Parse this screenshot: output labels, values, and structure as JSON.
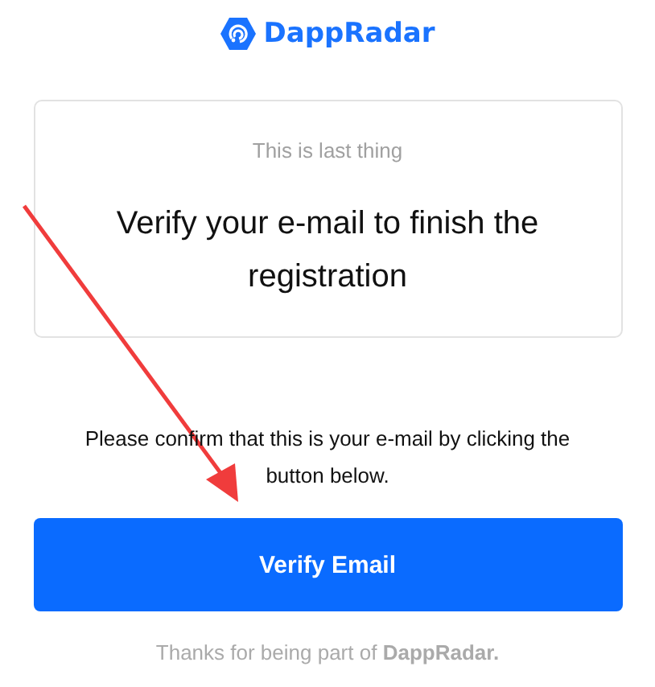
{
  "logo": {
    "text": "DappRadar"
  },
  "card": {
    "subtitle": "This is last thing",
    "headline": "Verify your e-mail to finish the registration"
  },
  "message": "Please confirm that this is your e-mail by clicking the button below.",
  "button": {
    "label": "Verify Email"
  },
  "footer": "Thanks for being part of **DappRadar.**"
}
